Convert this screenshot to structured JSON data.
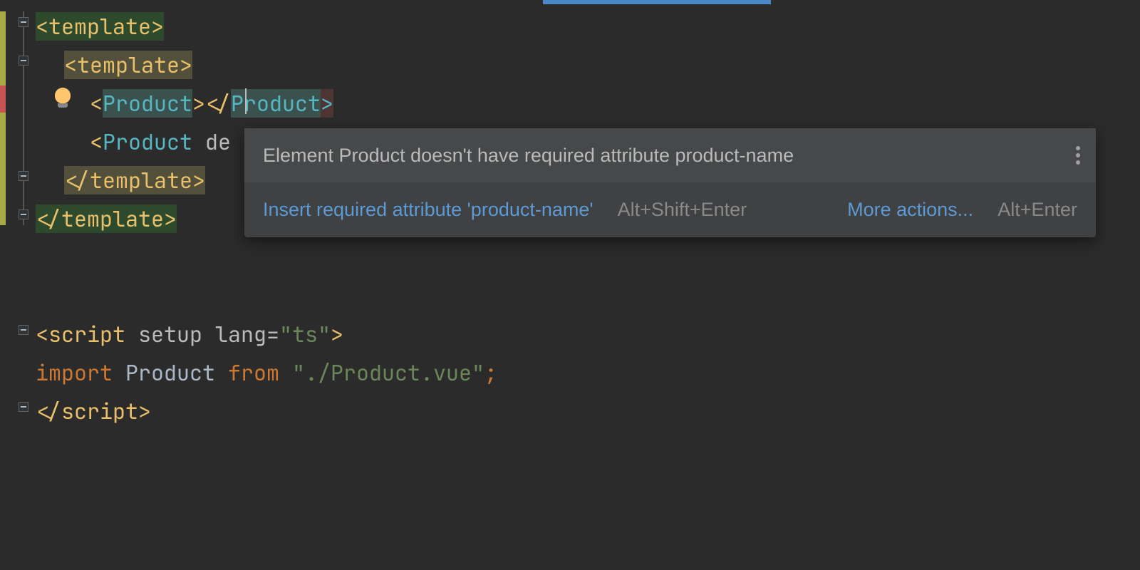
{
  "code": {
    "line1": {
      "open": "<",
      "tag": "template",
      "close": ">"
    },
    "line2": {
      "open": "<",
      "tag": "template",
      "close": ">"
    },
    "line3": {
      "open": "<",
      "comp": "Product",
      "mid": "></",
      "comp2": "Product",
      "close": ">"
    },
    "line4": {
      "open": "<",
      "comp": "Product",
      "sp": " ",
      "attr": "de"
    },
    "line5": {
      "open": "</",
      "tag": "template",
      "close": ">"
    },
    "line6": {
      "open": "</",
      "tag": "template",
      "close": ">"
    },
    "line8": {
      "open": "<",
      "tag": "script",
      "sp": " ",
      "attr1": "setup",
      "sp2": " ",
      "attr2": "lang",
      "eq": "=",
      "val": "\"ts\"",
      "close": ">"
    },
    "line9": {
      "kw": "import",
      "sp": " ",
      "ident": "Product",
      "sp2": " ",
      "kw2": "from",
      "sp3": " ",
      "str": "\"./Product.vue\"",
      "semi": ";"
    },
    "line10": {
      "open": "</",
      "tag": "script",
      "close": ">"
    }
  },
  "popup": {
    "message": "Element Product doesn't have required attribute product-name",
    "action1": "Insert required attribute 'product-name'",
    "shortcut1": "Alt+Shift+Enter",
    "action2": "More actions...",
    "shortcut2": "Alt+Enter"
  }
}
